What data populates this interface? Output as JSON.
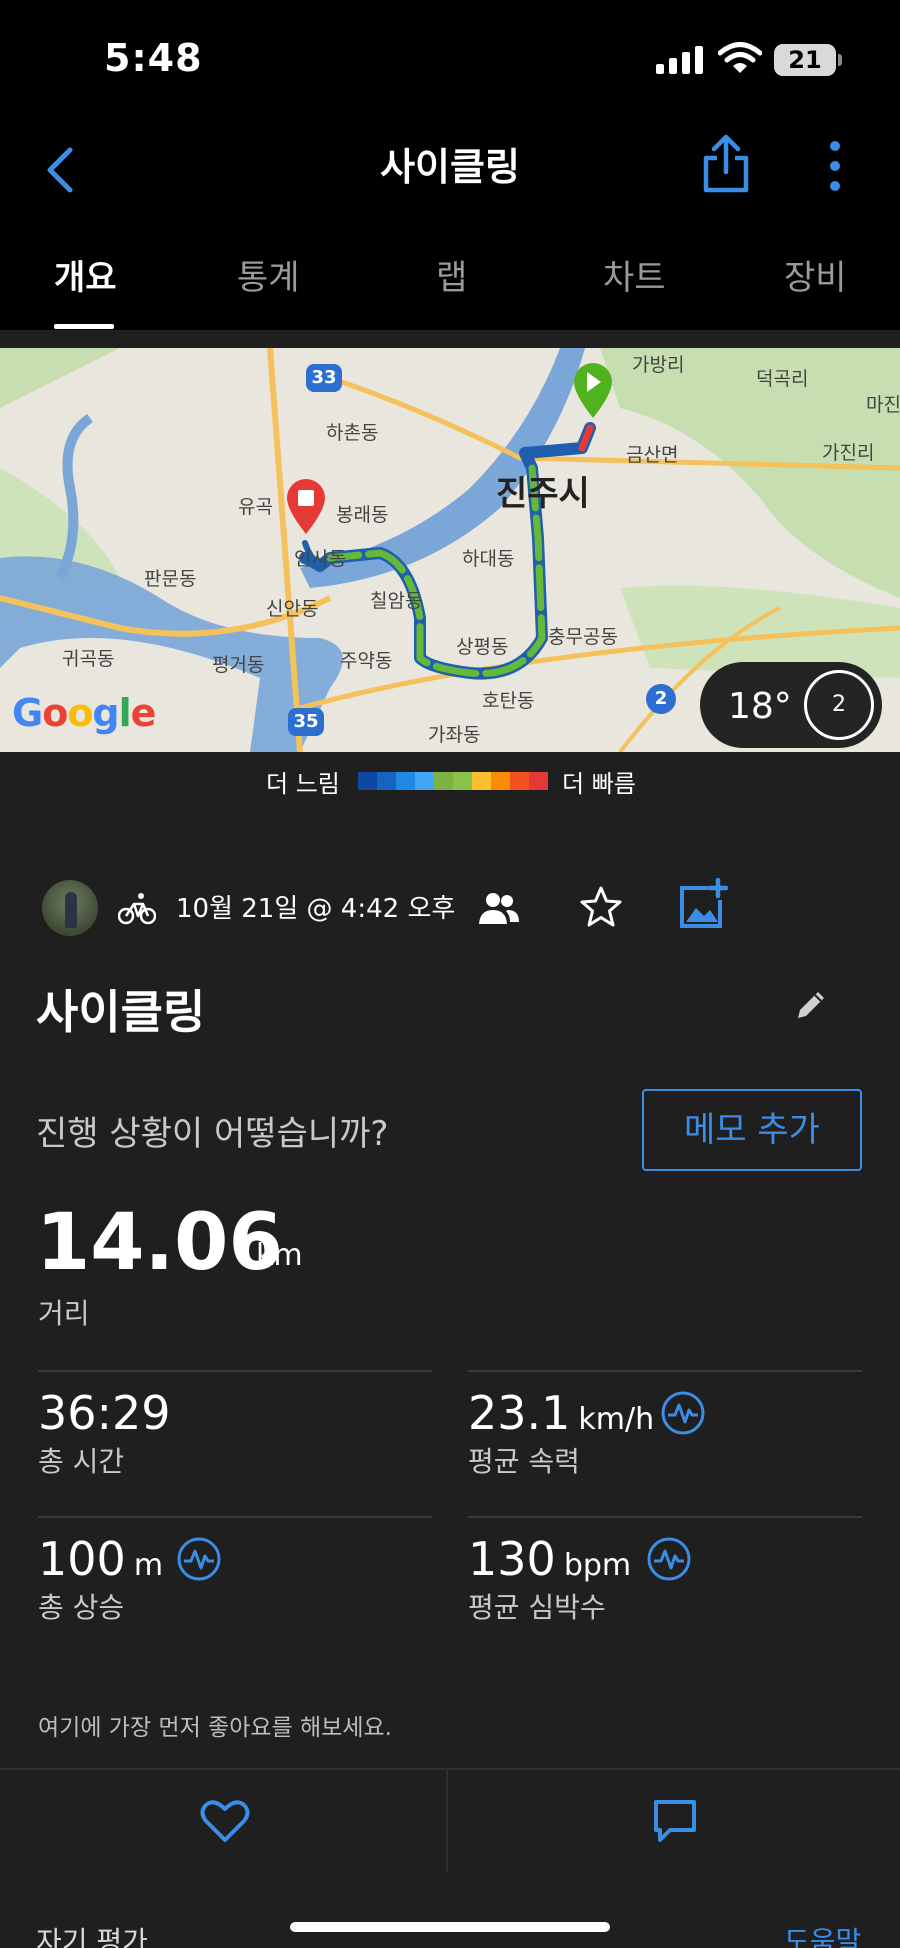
{
  "status_bar": {
    "time": "5:48",
    "battery": "21"
  },
  "header": {
    "title": "사이클링"
  },
  "tabs": [
    "개요",
    "통계",
    "랩",
    "차트",
    "장비"
  ],
  "map": {
    "labels": {
      "gabang": "가방리",
      "deokgok": "덕곡리",
      "mado": "마진",
      "hachon": "하촌동",
      "geumsan": "금산면",
      "gajin": "가진리",
      "jinju": "진주시",
      "yugok": "유곡",
      "bongrae": "봉래동",
      "insa": "인사동",
      "hadae": "하대동",
      "panmun": "판문동",
      "sinan": "신안동",
      "chilam": "칠암동",
      "sangpyeong": "상평동",
      "chungmu": "충무공동",
      "gwigok": "귀곡동",
      "pyeonggeo": "평거동",
      "juyak": "주약동",
      "hotan": "호탄동",
      "gajwa": "가좌동"
    },
    "shields": {
      "r33": "33",
      "r35": "35",
      "r2": "2"
    },
    "google_label": "Google",
    "weather_temp": "18°",
    "wind_value": "2",
    "colors": {
      "water": "#7aa6d8",
      "land": "#e9e6dd",
      "green": "#c7dfb0",
      "route_outer": "#1f5fae",
      "route_inner": "#66b83a",
      "start": "#4fb21e",
      "end": "#e53935"
    }
  },
  "legend": {
    "slow": "더 느림",
    "fast": "더 빠름",
    "colors": [
      "#0d47a1",
      "#1565c0",
      "#1e88e5",
      "#42a5f5",
      "#7cb342",
      "#8bc34a",
      "#fbc02d",
      "#fb8c00",
      "#f4511e",
      "#e53935"
    ]
  },
  "activity": {
    "date": "10월 21일 @ 4:42 오후",
    "title": "사이클링",
    "prompt": "진행 상황이 어떻습니까?",
    "memo_button": "메모 추가",
    "distance": {
      "value": "14.06",
      "unit": "km",
      "label": "거리"
    },
    "stats": [
      {
        "value": "36:29",
        "unit": "",
        "label": "총 시간"
      },
      {
        "value": "23.1",
        "unit": "km/h",
        "label": "평균 속력"
      },
      {
        "value": "100",
        "unit": "m",
        "label": "총 상승"
      },
      {
        "value": "130",
        "unit": "bpm",
        "label": "평균 심박수"
      }
    ],
    "likes_text": "여기에 가장 먼저 좋아요를 해보세요."
  },
  "footer": {
    "self_eval": "자기 평가",
    "help": "도움말"
  },
  "accent_color": "#3b8de6"
}
